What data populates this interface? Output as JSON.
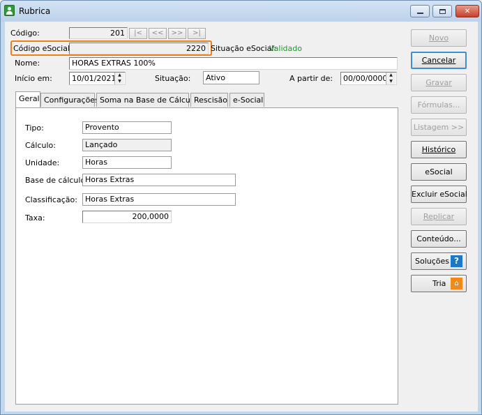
{
  "window": {
    "title": "Rubrica"
  },
  "header": {
    "codigo_label": "Código:",
    "codigo_value": "201",
    "nav": [
      "|<",
      "<<",
      ">>",
      ">|"
    ],
    "codigo_esocial_label": "Código eSocial:",
    "codigo_esocial_value": "2220",
    "situacao_esocial_label": "Situação eSocial:",
    "situacao_esocial_value": "Validado",
    "nome_label": "Nome:",
    "nome_value": "HORAS EXTRAS 100%",
    "inicio_label": "Início em:",
    "inicio_value": "10/01/2021",
    "situacao_label": "Situação:",
    "situacao_value": "Ativo",
    "a_partir_label": "A partir de:",
    "a_partir_value": "00/00/0000"
  },
  "tabs": [
    {
      "label": "Geral",
      "active": true
    },
    {
      "label": "Configurações",
      "active": false
    },
    {
      "label": "Soma na Base de Cálculo",
      "active": false
    },
    {
      "label": "Rescisão",
      "active": false
    },
    {
      "label": "e-Social",
      "active": false
    }
  ],
  "geral": {
    "tipo_label": "Tipo:",
    "tipo_value": "Provento",
    "calculo_label": "Cálculo:",
    "calculo_value": "Lançado",
    "unidade_label": "Unidade:",
    "unidade_value": "Horas",
    "base_label": "Base de cálculo:",
    "base_value": "Horas Extras",
    "classificacao_label": "Classificação:",
    "classificacao_value": "Horas Extras",
    "taxa_label": "Taxa:",
    "taxa_value": "200,0000"
  },
  "buttons": {
    "novo": "Novo",
    "cancelar": "Cancelar",
    "gravar": "Gravar",
    "formulas": "Fórmulas...",
    "listagem": "Listagem >>",
    "historico": "Histórico",
    "esocial": "eSocial",
    "excluir_esocial": "Excluir eSocial",
    "replicar": "Replicar",
    "conteudo": "Conteúdo...",
    "solucoes": "Soluções",
    "triagem": "Tria"
  },
  "colors": {
    "highlight": "#f07f1a",
    "status_ok": "#1f9a2a",
    "help": "#1a78c8"
  }
}
